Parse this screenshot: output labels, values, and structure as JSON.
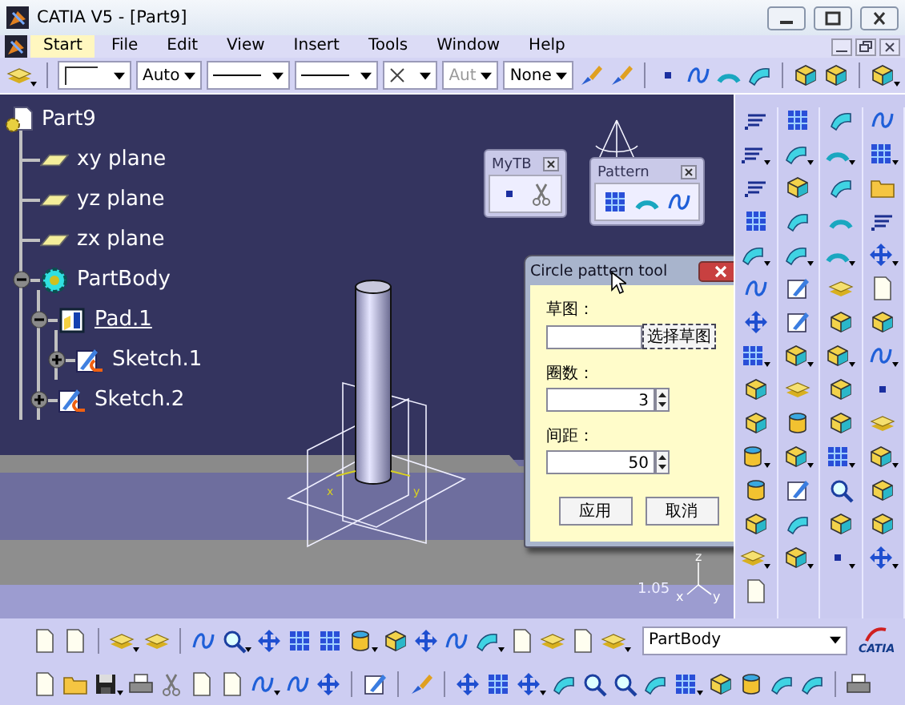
{
  "window": {
    "title": "CATIA V5 - [Part9]"
  },
  "menu": [
    {
      "label": "Start",
      "selected": true
    },
    {
      "label": "File",
      "selected": false
    },
    {
      "label": "Edit",
      "selected": false
    },
    {
      "label": "View",
      "selected": false
    },
    {
      "label": "Insert",
      "selected": false
    },
    {
      "label": "Tools",
      "selected": false
    },
    {
      "label": "Window",
      "selected": false
    },
    {
      "label": "Help",
      "selected": false
    }
  ],
  "toolbar_combos": [
    {
      "kind": "swatch"
    },
    {
      "kind": "text",
      "value": "Auto",
      "disabled": false
    },
    {
      "kind": "line"
    },
    {
      "kind": "line"
    },
    {
      "kind": "cross"
    },
    {
      "kind": "text",
      "value": "Aut",
      "disabled": true
    },
    {
      "kind": "text",
      "value": "None",
      "disabled": false
    }
  ],
  "tree": {
    "label": "Part9",
    "kind": "part",
    "current": false,
    "children": [
      {
        "label": "xy plane",
        "kind": "plane",
        "current": false
      },
      {
        "label": "yz plane",
        "kind": "plane",
        "current": false
      },
      {
        "label": "zx plane",
        "kind": "plane",
        "current": false
      },
      {
        "label": "PartBody",
        "kind": "body",
        "current": false,
        "expanded": true,
        "children": [
          {
            "label": "Pad.1",
            "kind": "pad",
            "current": true,
            "expanded": true,
            "children": [
              {
                "label": "Sketch.1",
                "kind": "sketch",
                "current": false,
                "expanded": false
              }
            ]
          },
          {
            "label": "Sketch.2",
            "kind": "sketch",
            "current": false,
            "expanded": false
          }
        ]
      }
    ]
  },
  "floating_toolbars": [
    {
      "title": "MyTB"
    },
    {
      "title": "Pattern"
    }
  ],
  "dialog": {
    "title": "Circle pattern tool",
    "fields": [
      {
        "label": "草图：",
        "kind": "pick",
        "button": "选择草图"
      },
      {
        "label": "圈数：",
        "kind": "spin",
        "value": "3"
      },
      {
        "label": "间距：",
        "kind": "spin",
        "value": "50"
      }
    ],
    "buttons": [
      "应用",
      "取消"
    ]
  },
  "viewport": {
    "scale": "1.05",
    "axes": [
      "z",
      "x",
      "y"
    ],
    "sketch_axes": [
      "x",
      "y"
    ]
  },
  "work_object_combo": {
    "value": "PartBody"
  },
  "logo": {
    "text": "CATIA"
  }
}
